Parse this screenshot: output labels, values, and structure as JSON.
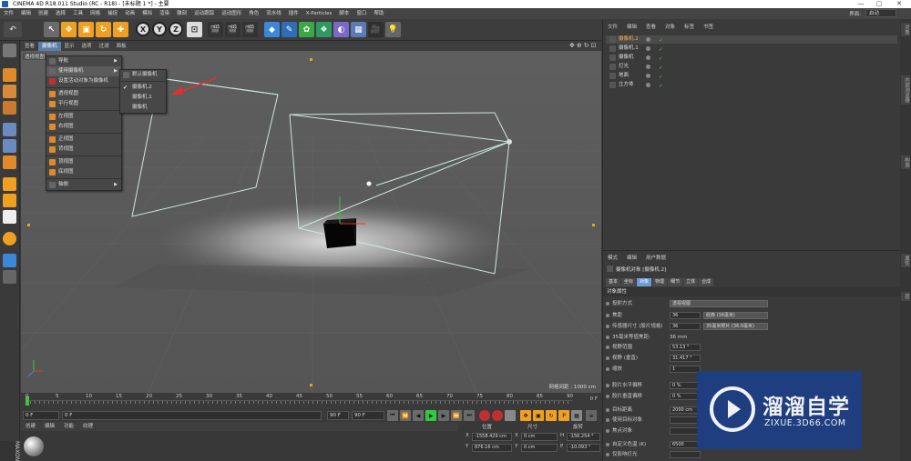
{
  "window": {
    "title": "CINEMA 4D R18.011 Studio (RC - R18) - [未标题 1 *] - 主要",
    "controls": [
      "—",
      "▢",
      "✕"
    ]
  },
  "menubar": {
    "items": [
      "文件",
      "编辑",
      "创建",
      "选择",
      "工具",
      "网格",
      "捕捉",
      "动画",
      "模拟",
      "渲染",
      "雕刻",
      "运动跟踪",
      "运动图形",
      "角色",
      "流水线",
      "插件",
      "X-Particles",
      "脚本",
      "窗口",
      "帮助"
    ],
    "layout_label": "界面:",
    "layout_value": "启动"
  },
  "viewport": {
    "menu": [
      "查看",
      "摄像机",
      "显示",
      "选项",
      "过滤",
      "面板"
    ],
    "active_menu": "摄像机",
    "label": "透视视图",
    "grid_distance": "网格间距 : 1000 cm",
    "nav_icons": [
      "move-icon",
      "zoom-icon",
      "rotate-icon",
      "maximize-icon"
    ]
  },
  "camera_menu": {
    "items": [
      {
        "label": "导航",
        "submenu": true
      },
      {
        "label": "使用摄像机",
        "submenu": true,
        "highlighted": true
      },
      {
        "label": "设置活动对象为摄像机"
      },
      {
        "sep": true
      },
      {
        "label": "透视视图"
      },
      {
        "label": "平行视图"
      },
      {
        "sep": true
      },
      {
        "label": "左视图"
      },
      {
        "label": "右视图"
      },
      {
        "sep": true
      },
      {
        "label": "正视图"
      },
      {
        "label": "背视图"
      },
      {
        "sep": true
      },
      {
        "label": "顶视图"
      },
      {
        "label": "底视图"
      },
      {
        "sep": true
      },
      {
        "label": "轴侧",
        "submenu": true
      }
    ],
    "submenu": [
      {
        "label": "默认摄像机"
      },
      {
        "sep": true
      },
      {
        "label": "摄像机.2",
        "checked": true
      },
      {
        "label": "摄像机.1"
      },
      {
        "label": "摄像机"
      }
    ]
  },
  "timeline": {
    "ticks": [
      "0",
      "5",
      "10",
      "15",
      "20",
      "25",
      "30",
      "35",
      "40",
      "45",
      "50",
      "55",
      "60",
      "65",
      "70",
      "75",
      "80",
      "85",
      "90"
    ],
    "current_frame": "0 F"
  },
  "transport": {
    "start": "0 F",
    "min": "0 F",
    "max": "90 F",
    "end": "90 F"
  },
  "material_bar": [
    "创建",
    "编辑",
    "功能",
    "纹理"
  ],
  "coords": {
    "headers": [
      "位置",
      "尺寸",
      "旋转"
    ],
    "rows": [
      {
        "axis": "X",
        "pos": "-1558.429 cm",
        "size": "0 cm",
        "rot_label": "H",
        "rot": "-156.254 °"
      },
      {
        "axis": "Y",
        "pos": "876.16 cm",
        "size": "0 cm",
        "rot_label": "P",
        "rot": "-10.093 °"
      }
    ]
  },
  "object_manager": {
    "menu": [
      "文件",
      "编辑",
      "查看",
      "对象",
      "标签",
      "书签"
    ],
    "objects": [
      {
        "name": "摄像机.2",
        "selected": true,
        "color": "#d9a441"
      },
      {
        "name": "摄像机.1",
        "color": "#bbbbbb"
      },
      {
        "name": "摄像机",
        "color": "#bbbbbb"
      },
      {
        "name": "灯光",
        "color": "#cccccc"
      },
      {
        "name": "地面",
        "color": "#5aa0d8"
      },
      {
        "name": "立方体",
        "color": "#5aa0d8"
      }
    ]
  },
  "attributes": {
    "menu": [
      "模式",
      "编辑",
      "用户数据"
    ],
    "title": "摄像机对象 [摄像机.2]",
    "tabs": [
      "基本",
      "坐标",
      "对象",
      "物理",
      "细节",
      "立体",
      "合成"
    ],
    "active_tab": "对象",
    "section": "对象属性",
    "rows": [
      {
        "label": "投射方式",
        "value": "透视视图",
        "type": "dropdown"
      },
      {
        "label": "焦距",
        "value": "36",
        "extra": "经典 (36毫米)"
      },
      {
        "label": "传感器尺寸 (胶片规格)",
        "value": "36",
        "extra": "35毫米照片 (36.0毫米)"
      },
      {
        "label": "35毫米等值焦距:",
        "value": "36 mm",
        "type": "text"
      },
      {
        "label": "视野范围",
        "value": "53.13 °"
      },
      {
        "label": "视野 (垂直)",
        "value": "31.417 °"
      },
      {
        "label": "缩放",
        "value": "1"
      },
      {
        "label": "胶片水平偏移",
        "value": "0 %"
      },
      {
        "label": "胶片垂直偏移",
        "value": "0 %"
      },
      {
        "label": "目标距离",
        "value": "2000 cm"
      },
      {
        "label": "使用目标对象",
        "value": ""
      },
      {
        "label": "焦点对象",
        "value": ""
      },
      {
        "label": "自定义色温 (K)",
        "value": "6500"
      },
      {
        "label": "仅影响灯光",
        "value": ""
      }
    ]
  },
  "right_tabs": [
    "对象",
    "内容浏览器",
    "构造",
    "属性",
    "层"
  ],
  "watermark": {
    "cn": "溜溜自学",
    "url": "ZIXUE.3D66.COM"
  }
}
